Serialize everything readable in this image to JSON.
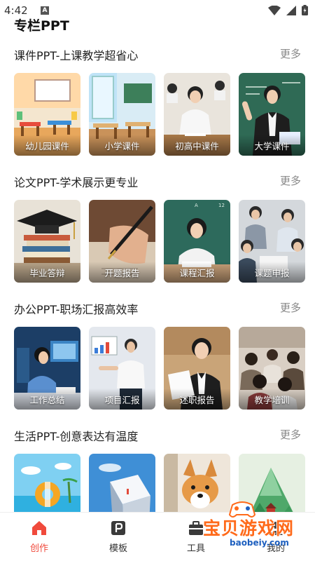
{
  "status": {
    "time": "4:42"
  },
  "page": {
    "title": "专栏PPT"
  },
  "sections": [
    {
      "title": "课件PPT-上课教学超省心",
      "more": "更多",
      "cards": [
        {
          "label": "幼儿园课件"
        },
        {
          "label": "小学课件"
        },
        {
          "label": "初高中课件"
        },
        {
          "label": "大学课件"
        }
      ]
    },
    {
      "title": "论文PPT-学术展示更专业",
      "more": "更多",
      "cards": [
        {
          "label": "毕业答辩"
        },
        {
          "label": "开题报告"
        },
        {
          "label": "课程汇报"
        },
        {
          "label": "课题申报"
        }
      ]
    },
    {
      "title": "办公PPT-职场汇报高效率",
      "more": "更多",
      "cards": [
        {
          "label": "工作总结"
        },
        {
          "label": "项目汇报"
        },
        {
          "label": "述职报告"
        },
        {
          "label": "教学培训"
        }
      ]
    },
    {
      "title": "生活PPT-创意表达有温度",
      "more": "更多",
      "cards": [
        {
          "label": ""
        },
        {
          "label": ""
        },
        {
          "label": ""
        },
        {
          "label": ""
        }
      ]
    }
  ],
  "nav": {
    "items": [
      {
        "label": "创作",
        "icon": "home-icon",
        "active": true
      },
      {
        "label": "模板",
        "icon": "template-icon",
        "active": false
      },
      {
        "label": "工具",
        "icon": "toolbox-icon",
        "active": false
      },
      {
        "label": "我的",
        "icon": "profile-icon",
        "active": false
      }
    ]
  },
  "watermark": {
    "text": "宝贝游戏网",
    "url": "baobeiy.com"
  },
  "colors": {
    "accent": "#f04a3c",
    "more": "#888888",
    "watermark": "#ff6a1a"
  }
}
